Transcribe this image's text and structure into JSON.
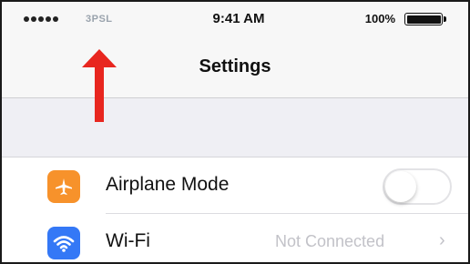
{
  "status_bar": {
    "carrier": "3PSL",
    "time": "9:41 AM",
    "battery_percent": "100%",
    "battery_level": 1.0
  },
  "nav": {
    "title": "Settings"
  },
  "settings": [
    {
      "id": "airplane",
      "label": "Airplane Mode",
      "icon": "airplane-icon",
      "icon_color": "#f7922b",
      "toggle_on": false
    },
    {
      "id": "wifi",
      "label": "Wi-Fi",
      "icon": "wifi-icon",
      "icon_color": "#3478f6",
      "value": "Not Connected",
      "chevron": "›"
    }
  ],
  "colors": {
    "annotation_arrow": "#e8261f",
    "background": "#efeff4"
  }
}
